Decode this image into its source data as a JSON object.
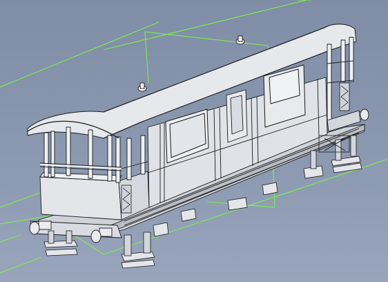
{
  "viewport": {
    "background_top": "#7f8da6",
    "background_bottom": "#98a5bb",
    "guide_line_color": "#7cf04a",
    "model_fill": "#e2e4e8",
    "model_edge": "#1a1a1a"
  },
  "model": {
    "subject": "railway-brake-van-3d-model",
    "view": "isometric-wireframe-shaded"
  }
}
